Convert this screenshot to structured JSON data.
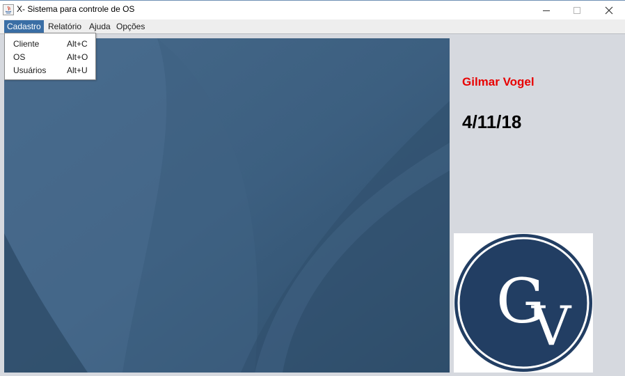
{
  "window": {
    "title": "X- Sistema para controle de OS",
    "controls": [
      "minimize",
      "maximize",
      "close"
    ]
  },
  "menubar": {
    "items": [
      {
        "label": "Cadastro",
        "active": true
      },
      {
        "label": "Relatório",
        "active": false
      },
      {
        "label": "Ajuda",
        "active": false
      },
      {
        "label": "Opções",
        "active": false
      }
    ]
  },
  "cadastro_menu": {
    "items": [
      {
        "label": "Cliente",
        "accelerator": "Alt+C"
      },
      {
        "label": "OS",
        "accelerator": "Alt+O"
      },
      {
        "label": "Usuários",
        "accelerator": "Alt+U"
      }
    ]
  },
  "sidebar": {
    "user_name": "Gilmar Vogel",
    "date": "4/11/18"
  },
  "logo": {
    "text": "GV",
    "circle_color": "#223e63"
  },
  "colors": {
    "menu_highlight": "#3a6ea5",
    "user_name": "#e80000",
    "desktop_base": "#3a5a78"
  }
}
